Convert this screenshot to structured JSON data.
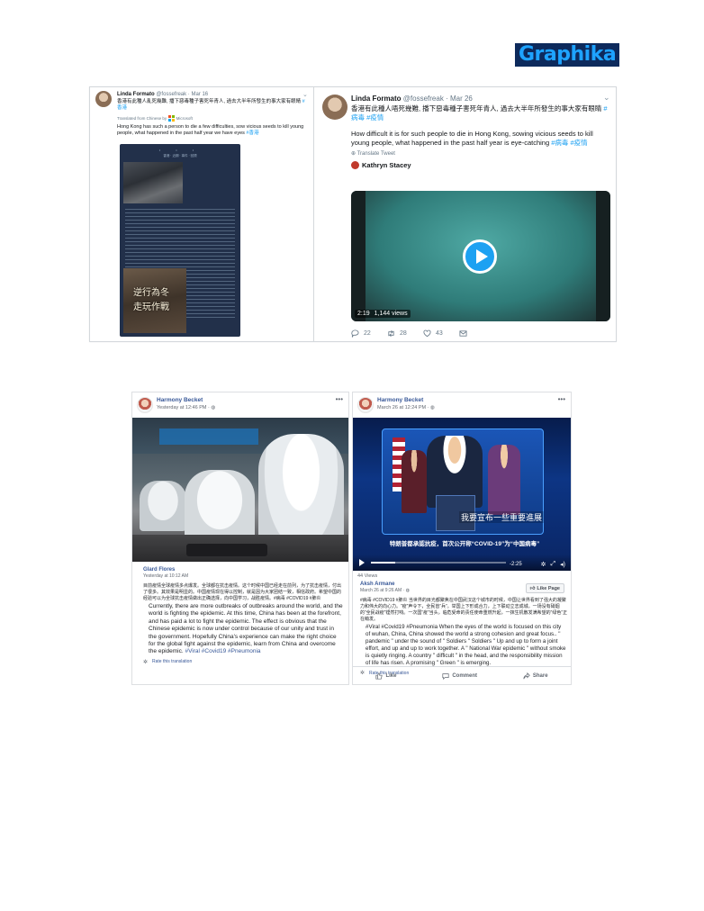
{
  "logo": {
    "text": "Graphika"
  },
  "tweet_left": {
    "name": "Linda Formato",
    "handle": "@fossefreak",
    "date": "Mar 16",
    "text_cn": "香港有此種人亂死幾難, 播下惡毒種子害死年青人, 過去大半年所發生的事大家有眼睛 ",
    "text_cn_tag": "#香港",
    "translated_by": "Translated from Chinese by",
    "translator": "Microsoft",
    "text_en": "Hong Kong has such a person to die a few difficulties, sow vicious seeds to kill young people, what happened in the past half year we have eyes ",
    "text_en_tag": "#香港",
    "poster": {
      "dots": "• • •",
      "subtitle": "香港 · 近期 · 事件 · 回顾",
      "caption_line1": "逆行為冬",
      "caption_line2": "走玩作戰"
    }
  },
  "tweet_right": {
    "name": "Linda Formato",
    "handle": "@fossefreak",
    "date": "Mar 26",
    "text_cn": "香港有此種人唔死幾難, 播下惡毒種子害死年青人, 過去大半年所發生的事大家有眼睛 ",
    "text_cn_tags": "#病毒 #疫情",
    "text_en": "How difficult it is for such people to die in Hong Kong, sowing vicious seeds to kill young people, what happened in the past half year is eye-catching ",
    "text_en_tags": "#病毒 #疫情",
    "translate_link": "Translate Tweet",
    "quoted_user": "Kathryn Stacey",
    "video": {
      "duration": "2:19",
      "views": "1,144 views"
    },
    "actions": {
      "replies": "22",
      "retweets": "28",
      "likes": "43"
    }
  },
  "fb_left": {
    "name": "Harmony Becket",
    "time": "Yesterday at 12:46 PM · ",
    "commenter": "Glard Flores",
    "comment_time": "Yesterday at 10:12 AM",
    "text_cn": "目前疫情全球疫情多点爆发。全球都在抗击疫情。这个时候中国已经走在前列，为了抗击疫情，付出了很多。其效果是明显的。中国疫情现在得以控制，就是因为大家团结一致，相信政府。希望中国的经验可以为全球抗击疫情做出正确选择，向中国学习，战胜疫情。#病毒 #COVID19 #肺炎",
    "text_en": "Currently, there are more outbreaks of outbreaks around the world, and the world is fighting the epidemic. At this time, China has been at the forefront, and has paid a lot to fight the epidemic. The effect is obvious that the Chinese epidemic is now under control because of our unity and trust in the government. Hopefully China's experience can make the right choice for the global fight against the epidemic, learn from China and overcome the epidemic. ",
    "text_en_tags": "#Viral #Covid19 #Pneumonia",
    "rate": "Rate this translation"
  },
  "fb_right": {
    "name": "Harmony Becket",
    "time": "March 26 at 12:24 PM · ",
    "video": {
      "subtitle_main": "我要宣布一些重要進展",
      "subtitle_bottom": "特朗普都承認抗疫，首次公开称“COVID-19”为“中国病毒”",
      "time": "-2:25",
      "progress": 0.18
    },
    "views": "44 Views",
    "author": "Aksh Armane",
    "author_time": "March 26 at 9:26 AM · ",
    "like_page": "Like Page",
    "text_cn": "#病毒 #COVID19 #肺炎 当世界的目光都聚焦在中国武汉这个城市的时候，中国让世界看到了强大的凝聚力和伟大的向心力。“疫”声令下，全民皆“兵”。举国上下形成合力，上下联动立志成城。一场没有硝烟的“全民战疫”铿然打响。一次国“疫”当头，临危受命的责任使命重燃升起，一抹生机散发满希望的“绿色”正在萌发。",
    "text_en": "#Viral #Covid19 #Pneumonia When the eyes of the world is focused on this city of wuhan, China, China showed the world a strong cohesion and great focus.. \" pandemic \" under the sound of \" Soldiers \" Soldiers \" Up and up to form a joint effort, and up and up to work together. A \" National War epidemic \" without smoke is quietly ringing. A country \" difficult \" in the head, and the responsibility mission of life has risen. A promising \" Green \" is emerging.",
    "rate": "Rate this translation",
    "actions": {
      "like": "Like",
      "comment": "Comment",
      "share": "Share"
    }
  },
  "colors": {
    "twitter_blue": "#1da1f2",
    "facebook_blue": "#385898",
    "logo_bg": "#0d2a5c"
  }
}
